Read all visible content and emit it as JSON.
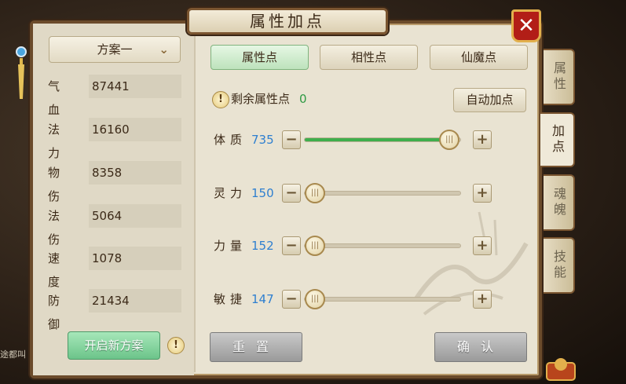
{
  "title": "属性加点",
  "close_label": "✕",
  "plan_selector": {
    "value": "方案一"
  },
  "stats": [
    {
      "label": "气血",
      "value": "87441"
    },
    {
      "label": "法力",
      "value": "16160"
    },
    {
      "label": "物伤",
      "value": "8358"
    },
    {
      "label": "法伤",
      "value": "5064"
    },
    {
      "label": "速度",
      "value": "1078"
    },
    {
      "label": "防御",
      "value": "21434"
    }
  ],
  "new_plan_button": "开启新方案",
  "warn_glyph": "!",
  "tabs": [
    {
      "label": "属性点",
      "active": true
    },
    {
      "label": "相性点",
      "active": false
    },
    {
      "label": "仙魔点",
      "active": false
    }
  ],
  "remaining": {
    "label": "剩余属性点",
    "value": "0"
  },
  "auto_button": "自动加点",
  "attributes": [
    {
      "label": "体质",
      "value": "735",
      "slider_fraction": 0.93
    },
    {
      "label": "灵力",
      "value": "150",
      "slider_fraction": 0.0
    },
    {
      "label": "力量",
      "value": "152",
      "slider_fraction": 0.0
    },
    {
      "label": "敏捷",
      "value": "147",
      "slider_fraction": 0.0
    }
  ],
  "minus_glyph": "−",
  "plus_glyph": "+",
  "reset_button": "重置",
  "confirm_button": "确认",
  "side_tabs": [
    {
      "label": "属性",
      "active": false
    },
    {
      "label": "加点",
      "active": true
    },
    {
      "label": "魂魄",
      "active": false
    },
    {
      "label": "技能",
      "active": false
    }
  ],
  "chat_fragment": "途都叫",
  "colors": {
    "accent_green": "#3fae4c",
    "value_blue": "#2e7fd0",
    "close_red": "#b21e17"
  }
}
